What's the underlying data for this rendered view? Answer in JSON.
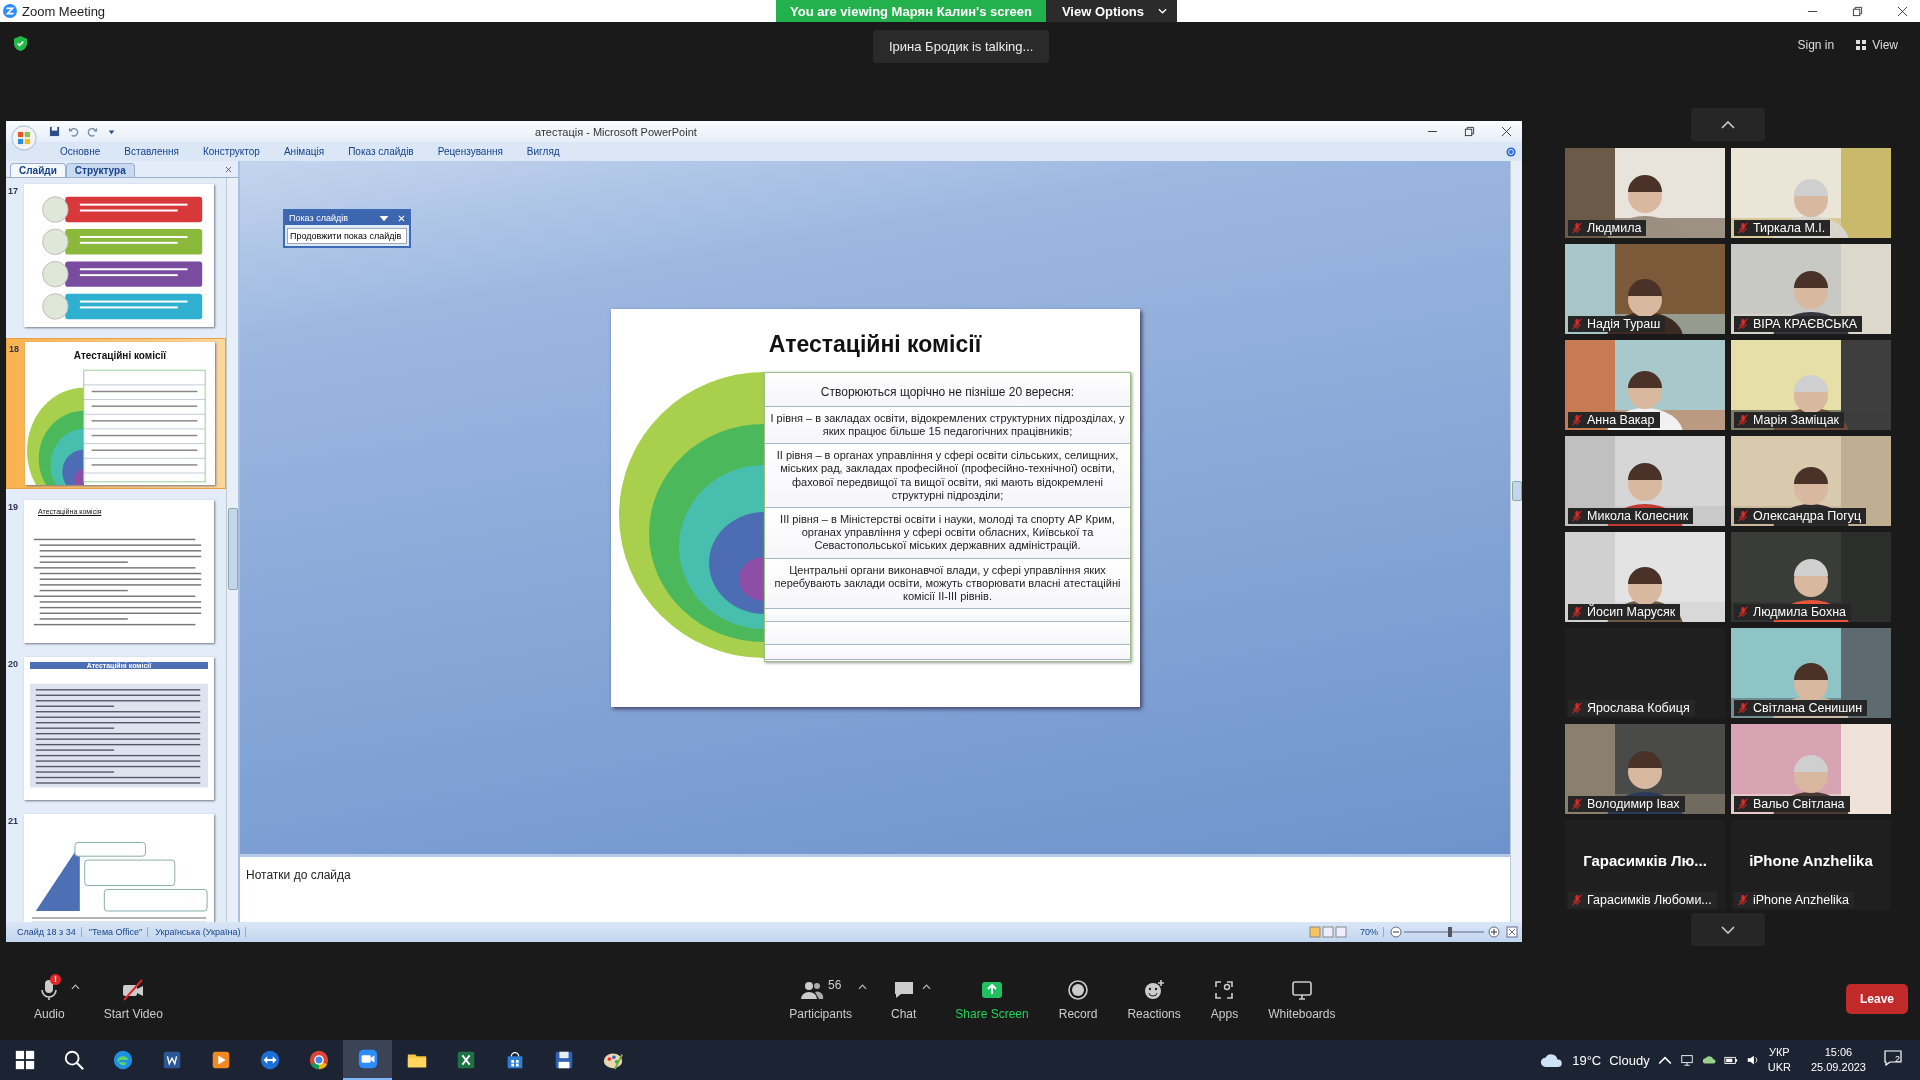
{
  "zoom_window": {
    "title": "Zoom Meeting"
  },
  "share_banner": {
    "text": "You are viewing Марян Калин's screen",
    "options": "View Options"
  },
  "talking_indicator": "Ірина Бродик is talking...",
  "top_right": {
    "sign_in": "Sign in",
    "view": "View"
  },
  "powerpoint": {
    "title": "атестація - Microsoft PowerPoint",
    "ribbon_tabs": [
      {
        "label": "Основне",
        "selected": false
      },
      {
        "label": "Вставлення",
        "selected": false
      },
      {
        "label": "Конструктор",
        "selected": false
      },
      {
        "label": "Анімація",
        "selected": false
      },
      {
        "label": "Показ слайдів",
        "selected": false
      },
      {
        "label": "Рецензування",
        "selected": false
      },
      {
        "label": "Вигляд",
        "selected": false
      }
    ],
    "pane_tabs": [
      {
        "label": "Слайди",
        "selected": true
      },
      {
        "label": "Структура",
        "selected": false
      }
    ],
    "thumbnails": [
      {
        "number": "17",
        "kind": "banners",
        "selected": false
      },
      {
        "number": "18",
        "kind": "rings",
        "title": "Атестаційні комісії",
        "selected": true
      },
      {
        "number": "19",
        "kind": "bullets",
        "title": "Атестаційна комісія",
        "selected": false
      },
      {
        "number": "20",
        "kind": "boxed",
        "title": "Атестаційні комісії",
        "selected": false
      },
      {
        "number": "21",
        "kind": "pyramid",
        "selected": false
      }
    ],
    "floating_toolbar": {
      "title": "Показ слайдів",
      "command": "Продовжити показ слайдів"
    },
    "slide": {
      "title": "Атестаційні комісії",
      "rows": [
        {
          "kind": "heading",
          "text": "Створюються щорічно не пізніше 20 вересня:"
        },
        {
          "kind": "item",
          "text": "І рівня – в закладах освіти, відокремлених структурних підрозділах, у яких працює більше 15 педагогічних працівників;"
        },
        {
          "kind": "item",
          "text": "ІІ рівня – в органах управління у сфері освіти сільських, селищних, міських рад, закладах професійної (професійно-технічної) освіти, фахової передвищої та вищої освіти, які мають відокремлені структурні підрозділи;"
        },
        {
          "kind": "item",
          "text": "ІІІ рівня – в Міністерстві освіти і науки, молоді та спорту АР Крим, органах управління у сфері освіти обласних, Київської та Севастопольської міських державних адміністрацій."
        },
        {
          "kind": "item",
          "text": "Центральні органи виконавчої влади, у сфері управління яких перебувають заклади освіти, можуть створювати власні атестаційні комісії ІІ-ІІІ рівнів."
        },
        {
          "kind": "empty"
        },
        {
          "kind": "empty"
        },
        {
          "kind": "empty"
        }
      ]
    },
    "notes_placeholder": "Нотатки до слайда",
    "status_bar": [
      "Слайд 18 з 34",
      "\"Тема Office\"",
      "Українська (Україна)"
    ],
    "zoom_level": "70%"
  },
  "participants": [
    {
      "name": "Людмила",
      "kind": "video",
      "muted": true
    },
    {
      "name": "Тиркала М.І.",
      "kind": "video",
      "muted": true
    },
    {
      "name": "Надія Тураш",
      "kind": "video",
      "muted": true
    },
    {
      "name": "ВІРА КРАЄВСЬКА",
      "kind": "video",
      "muted": true
    },
    {
      "name": "Анна Вакар",
      "kind": "video",
      "muted": true
    },
    {
      "name": "Марія Заміщак",
      "kind": "video",
      "muted": true
    },
    {
      "name": "Микола Колесник",
      "kind": "video",
      "muted": true
    },
    {
      "name": "Олександра Погуц",
      "kind": "video",
      "muted": true
    },
    {
      "name": "Йосип Марусяк",
      "kind": "video",
      "muted": true
    },
    {
      "name": "Людмила Бохна",
      "kind": "video",
      "muted": true
    },
    {
      "name": "Ярослава Кобиця",
      "kind": "blank",
      "muted": true
    },
    {
      "name": "Світлана Сенишин",
      "kind": "video",
      "muted": true
    },
    {
      "name": "Володимир Івах",
      "kind": "video",
      "muted": true
    },
    {
      "name": "Вальо Світлана",
      "kind": "video",
      "muted": true
    },
    {
      "name": "Гарасимків Любоми...",
      "display_name": "Гарасимків Лю...",
      "kind": "name",
      "muted": true
    },
    {
      "name": "iPhone Anzhelika",
      "display_name": "iPhone Anzhelika",
      "kind": "name",
      "muted": true
    }
  ],
  "toolbar": [
    {
      "label": "Audio",
      "kind": "audio",
      "alert": "!"
    },
    {
      "label": "Start Video",
      "kind": "video"
    },
    {
      "label": "Participants",
      "kind": "participants",
      "count": "56"
    },
    {
      "label": "Chat",
      "kind": "chat"
    },
    {
      "label": "Share Screen",
      "kind": "share"
    },
    {
      "label": "Record",
      "kind": "record"
    },
    {
      "label": "Reactions",
      "kind": "reactions"
    },
    {
      "label": "Apps",
      "kind": "apps"
    },
    {
      "label": "Whiteboards",
      "kind": "whiteboards"
    }
  ],
  "leave": "Leave",
  "taskbar": {
    "apps": [
      {
        "kind": "start",
        "selected": false
      },
      {
        "kind": "search",
        "selected": false
      },
      {
        "kind": "browser",
        "selected": false
      },
      {
        "kind": "document",
        "selected": false
      },
      {
        "kind": "media",
        "selected": false
      },
      {
        "kind": "remote",
        "selected": false
      },
      {
        "kind": "chrome",
        "selected": false
      },
      {
        "kind": "zoom",
        "selected": true
      },
      {
        "kind": "folder",
        "selected": false
      },
      {
        "kind": "spreadsheet",
        "selected": false
      },
      {
        "kind": "store",
        "selected": false
      },
      {
        "kind": "save",
        "selected": false
      },
      {
        "kind": "paint",
        "selected": false
      }
    ],
    "temperature": "19°C",
    "weather": "Cloudy",
    "language": "УКР",
    "layout": "UKR",
    "time": "15:06",
    "date": "25.09.2023",
    "notifications": "2"
  }
}
